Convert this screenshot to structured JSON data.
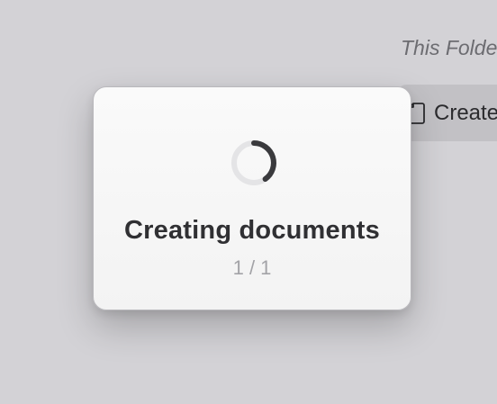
{
  "background": {
    "folder_label": "This Folder",
    "create_button_label": "Create",
    "create_button_icon": "document-icon"
  },
  "dialog": {
    "title": "Creating documents",
    "progress_text": "1 / 1",
    "spinner_icon": "spinner-icon"
  },
  "colors": {
    "backdrop": "#d3d2d6",
    "dialog_background": "#f7f7f7",
    "spinner_track": "#e4e4e6",
    "spinner_arc": "#3a3a3d"
  }
}
